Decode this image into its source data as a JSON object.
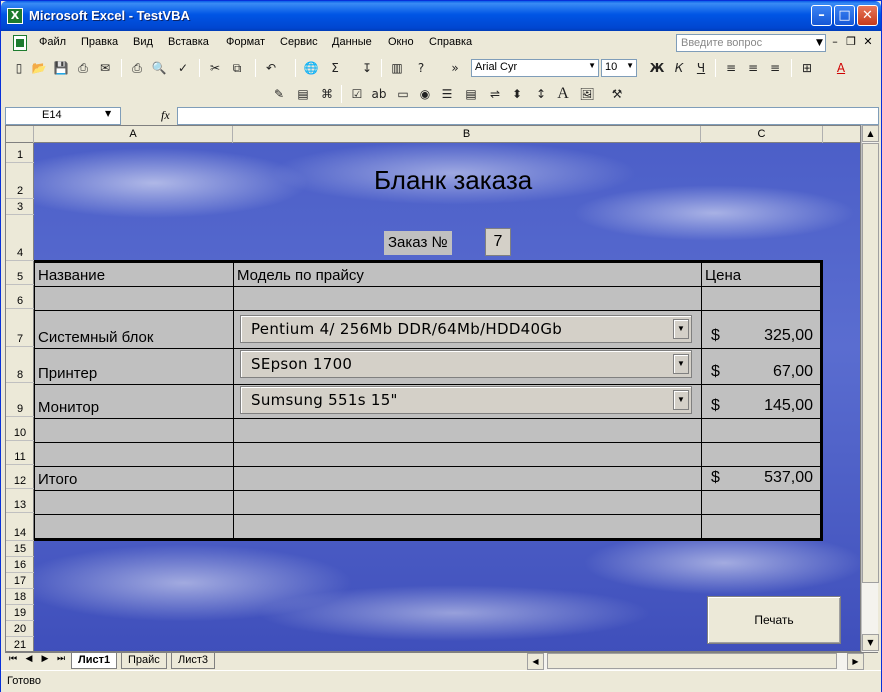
{
  "window": {
    "title": "Microsoft Excel - TestVBA",
    "app_icon": "X"
  },
  "menu": {
    "items": [
      "Файл",
      "Правка",
      "Вид",
      "Вставка",
      "Формат",
      "Сервис",
      "Данные",
      "Окно",
      "Справка"
    ],
    "ask_placeholder": "Введите вопрос"
  },
  "toolbar": {
    "font_name": "Arial Cyr",
    "font_size": "10",
    "bold": "Ж",
    "italic": "К",
    "underline": "Ч"
  },
  "formula_bar": {
    "cell_ref": "E14",
    "fx": "fx",
    "formula": ""
  },
  "sheet": {
    "columns": [
      "A",
      "B",
      "C"
    ],
    "rows": [
      "1",
      "2",
      "3",
      "4",
      "5",
      "6",
      "7",
      "8",
      "9",
      "10",
      "11",
      "12",
      "13",
      "14",
      "15",
      "16",
      "17",
      "18",
      "19",
      "20",
      "21"
    ]
  },
  "form": {
    "title": "Бланк заказа",
    "order_label": "Заказ №",
    "order_number": "7",
    "headers": {
      "name": "Название",
      "model": "Модель по прайсу",
      "price": "Цена"
    },
    "items": [
      {
        "name": "Системный блок",
        "model": "Pentium 4/ 256Mb DDR/64Mb/HDD40Gb",
        "currency": "$",
        "price": "325,00"
      },
      {
        "name": "Принтер",
        "model": "SEpson 1700",
        "currency": "$",
        "price": "67,00"
      },
      {
        "name": "Монитор",
        "model": "Sumsung 551s 15\"",
        "currency": "$",
        "price": "145,00"
      }
    ],
    "total": {
      "label": "Итого",
      "currency": "$",
      "value": "537,00"
    },
    "print_button": "Печать"
  },
  "tabs": [
    "Лист1",
    "Прайс",
    "Лист3"
  ],
  "status": {
    "text": "Готово"
  }
}
